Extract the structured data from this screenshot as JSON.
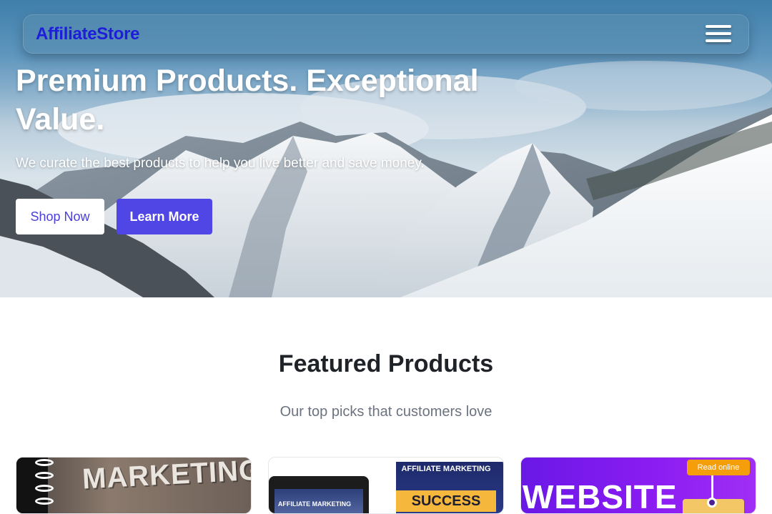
{
  "nav": {
    "brand": "AffiliateStore",
    "menu_icon": "hamburger-menu-icon"
  },
  "hero": {
    "title": "Premium Products. Exceptional Value.",
    "subtitle": "We curate the best products to help you live better and save money.",
    "shop_label": "Shop Now",
    "learn_label": "Learn More",
    "background": "snowy-mountain-landscape"
  },
  "featured": {
    "title": "Featured Products",
    "subtitle": "Our top picks that customers love",
    "cards": [
      {
        "cover_text": "MARKETING"
      },
      {
        "tablet_text": "AFFILIATE MARKETING",
        "book_title": "AFFILIATE MARKETING",
        "book_sub": "SUCCESS"
      },
      {
        "cover_text": "WEBSITE",
        "badge": "Read online"
      }
    ]
  },
  "colors": {
    "brand": "#1d1ddb",
    "accent": "#4f46e5",
    "badge": "#f59e0b"
  }
}
